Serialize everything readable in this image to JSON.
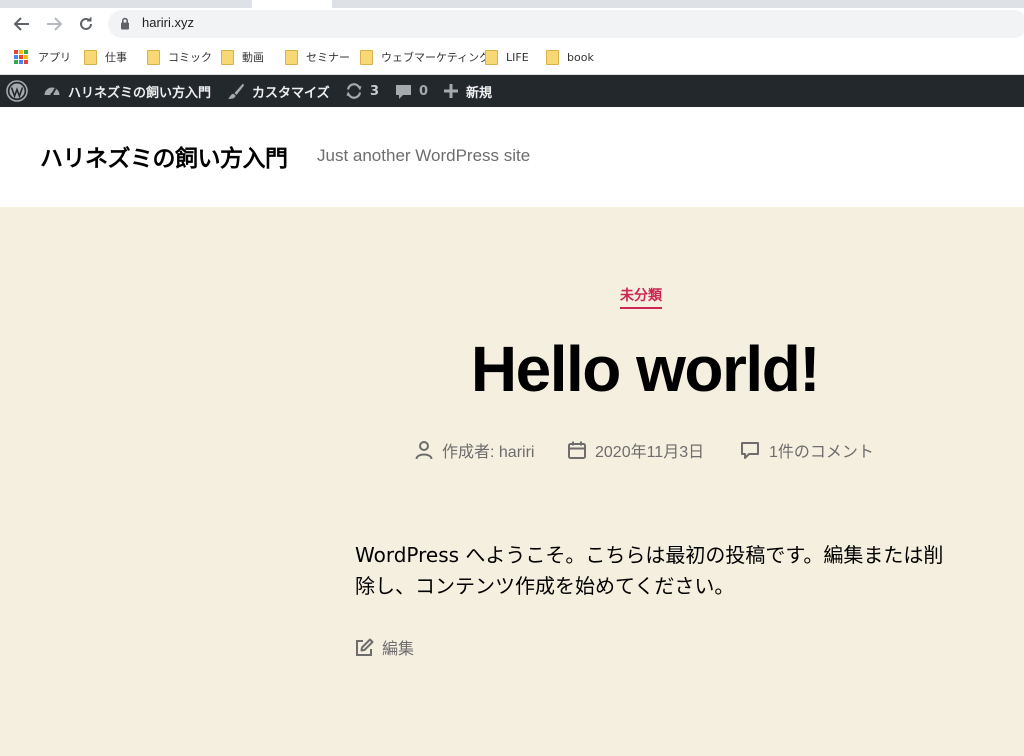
{
  "browser": {
    "url": "hariri.xyz",
    "bookmarks": [
      {
        "label": "アプリ",
        "icon": "apps-grid-icon"
      },
      {
        "label": "仕事",
        "icon": "folder-icon"
      },
      {
        "label": "コミック",
        "icon": "folder-icon"
      },
      {
        "label": "動画",
        "icon": "folder-icon"
      },
      {
        "label": "セミナー",
        "icon": "folder-icon"
      },
      {
        "label": "ウェブマーケティング",
        "icon": "folder-icon"
      },
      {
        "label": "LIFE",
        "icon": "folder-icon"
      },
      {
        "label": "book",
        "icon": "folder-icon"
      }
    ]
  },
  "adminbar": {
    "site_name": "ハリネズミの飼い方入門",
    "customize": "カスタマイズ",
    "updates_count": "3",
    "comments_count": "0",
    "new": "新規"
  },
  "site": {
    "title": "ハリネズミの飼い方入門",
    "description": "Just another WordPress site"
  },
  "post": {
    "category": "未分類",
    "title": "Hello world!",
    "author": "作成者: hariri",
    "date": "2020年11月3日",
    "comments": "1件のコメント",
    "body": "WordPress へようこそ。こちらは最初の投稿です。編集または削除し、コンテンツ作成を始めてください。",
    "edit": "編集"
  },
  "colors": {
    "accent": "#cd2653",
    "adminbar": "#23282d",
    "content_bg": "#f5efe0"
  }
}
